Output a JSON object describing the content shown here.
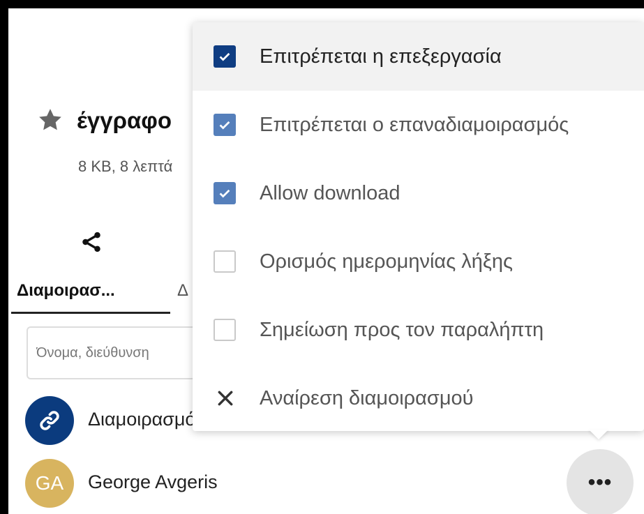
{
  "file": {
    "title": "έγγραφο",
    "meta": "8 KB, 8 λεπτά"
  },
  "tabs": {
    "active": "Διαμοιρασ...",
    "next": "Δ"
  },
  "search": {
    "placeholder": "Όνομα, διεύθυνση"
  },
  "share_rows": [
    {
      "label": "Διαμοιρασμός"
    },
    {
      "initials": "GA",
      "label": "George Avgeris"
    }
  ],
  "more_button": {
    "label": "•••"
  },
  "menu": {
    "items": [
      {
        "label": "Επιτρέπεται η επεξεργασία",
        "checked": true
      },
      {
        "label": "Επιτρέπεται ο επαναδιαμοιρασμός",
        "checked": true
      },
      {
        "label": "Allow download",
        "checked": true
      },
      {
        "label": "Ορισμός ημερομηνίας λήξης",
        "checked": false
      },
      {
        "label": "Σημείωση προς τον παραλήπτη",
        "checked": false
      },
      {
        "label": "Αναίρεση διαμοιρασμού"
      }
    ]
  },
  "colors": {
    "accent": "#0f3d82",
    "accent_muted": "#557fbb",
    "avatar_link": "#0b3b7e",
    "avatar_user": "#d8b45f"
  }
}
